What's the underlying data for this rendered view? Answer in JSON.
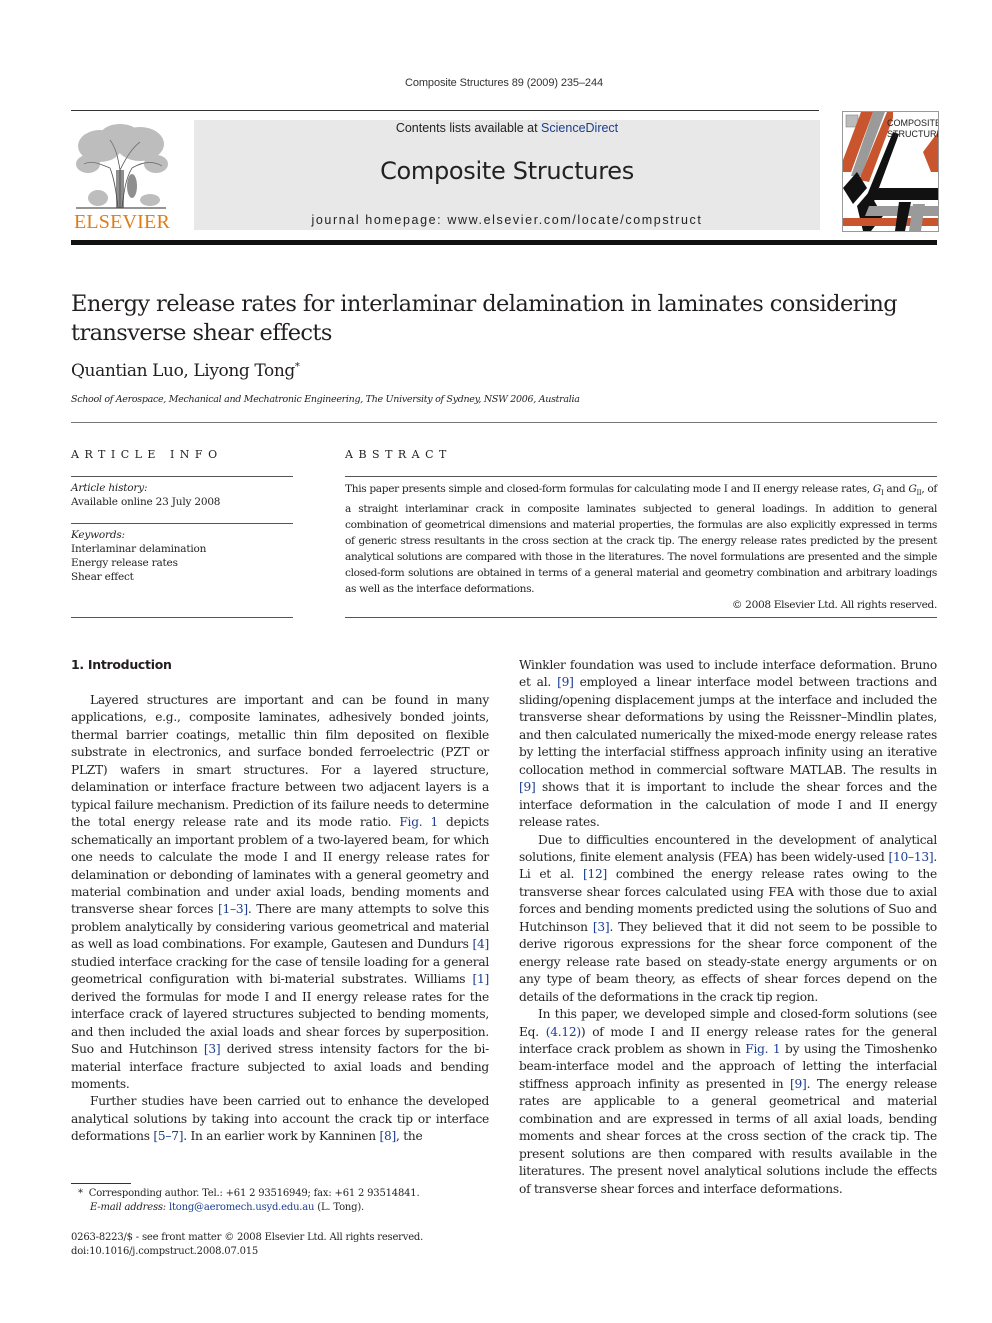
{
  "journal_reference": "Composite Structures 89 (2009) 235–244",
  "masthead": {
    "contents_prefix": "Contents lists available at ",
    "contents_link": "ScienceDirect",
    "journal_title": "Composite Structures",
    "homepage": "journal homepage: www.elsevier.com/locate/compstruct",
    "publisher_logo_text": "ELSEVIER",
    "cover_title_line1": "COMPOSITE",
    "cover_title_line2": "STRUCTURES",
    "colors": {
      "elsevier_orange": "#e07c16",
      "link_blue": "#1a3d8f",
      "cover_orange": "#c8552e",
      "cover_gray": "#9a9a9a"
    }
  },
  "article": {
    "title": "Energy release rates for interlaminar delamination in laminates considering transverse shear effects",
    "authors": "Quantian Luo, Liyong Tong",
    "author_mark": "*",
    "affiliation": "School of Aerospace, Mechanical and Mechatronic Engineering, The University of Sydney, NSW 2006, Australia"
  },
  "article_info": {
    "label": "ARTICLE INFO",
    "history_label": "Article history:",
    "history_value": "Available online 23 July 2008",
    "keywords_label": "Keywords:",
    "keywords": [
      "Interlaminar delamination",
      "Energy release rates",
      "Shear effect"
    ]
  },
  "abstract": {
    "label": "ABSTRACT",
    "text_part1": "This paper presents simple and closed-form formulas for calculating mode I and II energy release rates, ",
    "g1": "G",
    "g1_sub": "I",
    "text_part2": " and ",
    "g2": "G",
    "g2_sub": "II",
    "text_part3": ", of a straight interlaminar crack in composite laminates subjected to general loadings. In addition to general combination of geometrical dimensions and material properties, the formulas are also explicitly expressed in terms of generic stress resultants in the cross section at the crack tip. The energy release rates predicted by the present analytical solutions are compared with those in the literatures. The novel formulations are presented and the simple closed-form solutions are obtained in terms of a general material and geometry combination and arbitrary loadings as well as the interface deformations.",
    "copyright": "© 2008 Elsevier Ltd. All rights reserved."
  },
  "body": {
    "section_heading": "1. Introduction",
    "left_p1": {
      "t1": "Layered structures are important and can be found in many applications, e.g., composite laminates, adhesively bonded joints, thermal barrier coatings, metallic thin film deposited on flexible substrate in electronics, and surface bonded ferroelectric (PZT or PLZT) wafers in smart structures. For a layered structure, delamination or interface fracture between two adjacent layers is a typical failure mechanism. Prediction of its failure needs to determine the total energy release rate and its mode ratio. ",
      "r1": "Fig. 1",
      "t2": " depicts schematically an important problem of a two-layered beam, for which one needs to calculate the mode I and II energy release rates for delamination or debonding of laminates with a general geometry and material combination and under axial loads, bending moments and transverse shear forces ",
      "r2": "[1–3]",
      "t3": ". There are many attempts to solve this problem analytically by considering various geometrical and material as well as load combinations. For example, Gautesen and Dundurs ",
      "r3": "[4]",
      "t4": " studied interface cracking for the case of tensile loading for a general geometrical configuration with bi-material substrates. Williams ",
      "r4": "[1]",
      "t5": " derived the formulas for mode I and II energy release rates for the interface crack of layered structures subjected to bending moments, and then included the axial loads and shear forces by superposition. Suo and Hutchinson ",
      "r5": "[3]",
      "t6": " derived stress intensity factors for the bi-material interface fracture subjected to axial loads and bending moments."
    },
    "left_p2": {
      "t1": "Further studies have been carried out to enhance the developed analytical solutions by taking into account the crack tip or interface deformations ",
      "r1": "[5–7]",
      "t2": ". In an earlier work by Kanninen ",
      "r2": "[8]",
      "t3": ", the"
    },
    "right_p1": {
      "t1": "Winkler foundation was used to include interface deformation. Bruno et al. ",
      "r1": "[9]",
      "t2": " employed a linear interface model between tractions and sliding/opening displacement jumps at the interface and included the transverse shear deformations by using the Reissner–Mindlin plates, and then calculated numerically the mixed-mode energy release rates by letting the interfacial stiffness approach infinity using an iterative collocation method in commercial software MATLAB. The results in ",
      "r2": "[9]",
      "t3": " shows that it is important to include the shear forces and the interface deformation in the calculation of mode I and II energy release rates."
    },
    "right_p2": {
      "t1": "Due to difficulties encountered in the development of analytical solutions, finite element analysis (FEA) has been widely-used ",
      "r1": "[10–13]",
      "t2": ". Li et al. ",
      "r2": "[12]",
      "t3": " combined the energy release rates owing to the transverse shear forces calculated using FEA with those due to axial forces and bending moments predicted using the solutions of Suo and Hutchinson ",
      "r3": "[3]",
      "t4": ". They believed that it did not seem to be possible to derive rigorous expressions for the shear force component of the energy release rate based on steady-state energy arguments or on any type of beam theory, as effects of shear forces depend on the details of the deformations in the crack tip region."
    },
    "right_p3": {
      "t1": "In this paper, we developed simple and closed-form solutions (see Eq. ",
      "r1": "(4.12)",
      "t2": ") of mode I and II energy release rates for the general interface crack problem as shown in ",
      "r2": "Fig. 1",
      "t3": " by using the Timoshenko beam-interface model and the approach of letting the interfacial stiffness approach infinity as presented in ",
      "r3": "[9]",
      "t4": ". The energy release rates are applicable to a general geometrical and material combination and are expressed in terms of all axial loads, bending moments and shear forces at the cross section of the crack tip. The present solutions are then compared with results available in the literatures. The present novel analytical solutions include the effects of transverse shear forces and interface deformations."
    }
  },
  "footnote": {
    "mark": "*",
    "line1": "Corresponding author. Tel.: +61 2 93516949; fax: +61 2 93514841.",
    "email_label": "E-mail address:",
    "email": "ltong@aeromech.usyd.edu.au",
    "email_suffix": " (L. Tong)."
  },
  "front_matter": {
    "issn_line": "0263-8223/$ - see front matter © 2008 Elsevier Ltd. All rights reserved.",
    "doi": "doi:10.1016/j.compstruct.2008.07.015"
  }
}
